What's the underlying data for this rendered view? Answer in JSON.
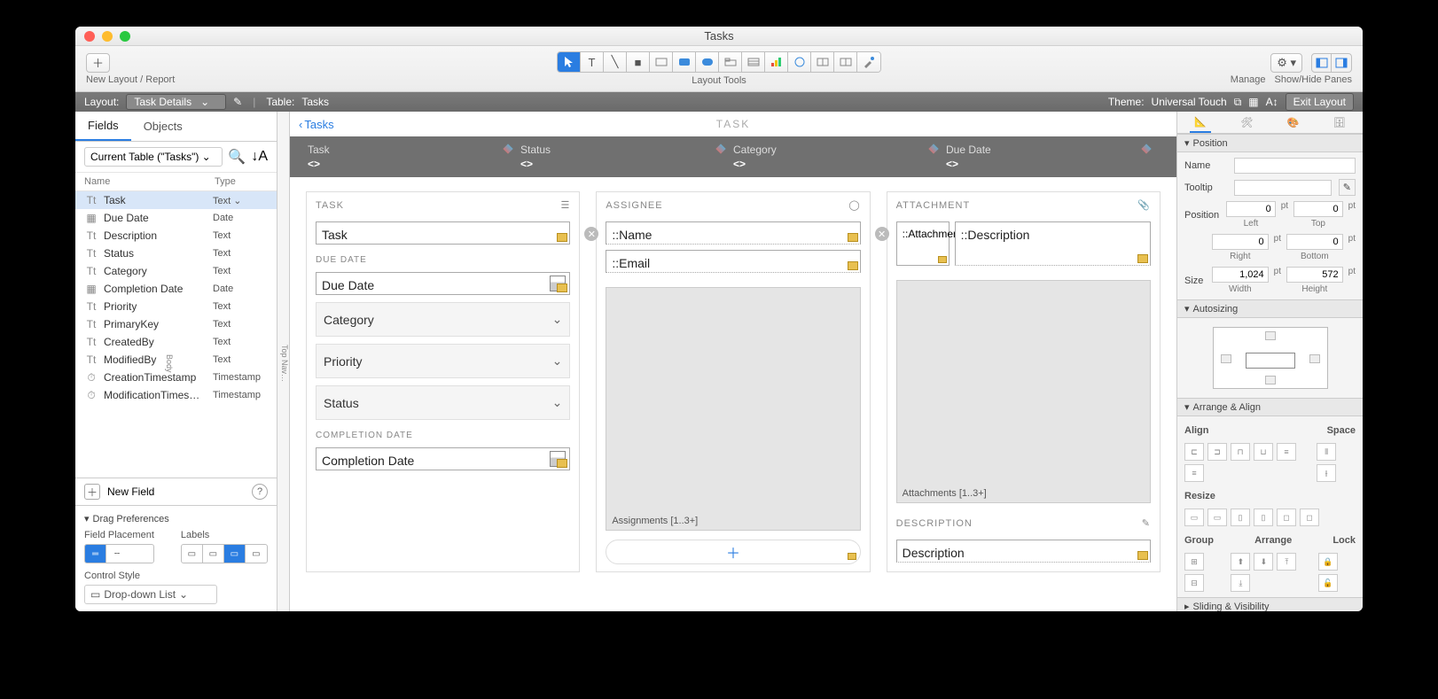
{
  "window": {
    "title": "Tasks"
  },
  "toolbar": {
    "newLayout": "New Layout / Report",
    "layoutTools": "Layout Tools",
    "manage": "Manage",
    "showHide": "Show/Hide Panes"
  },
  "statusbar": {
    "layoutLabel": "Layout:",
    "layoutName": "Task Details",
    "tableLabel": "Table:",
    "tableName": "Tasks",
    "themeLabel": "Theme:",
    "themeName": "Universal Touch",
    "exit": "Exit Layout"
  },
  "leftPanel": {
    "tabs": [
      "Fields",
      "Objects"
    ],
    "tableSelect": "Current Table (\"Tasks\")",
    "headers": {
      "name": "Name",
      "type": "Type"
    },
    "fields": [
      {
        "icon": "Tt",
        "name": "Task",
        "type": "Text",
        "sel": true
      },
      {
        "icon": "▦",
        "name": "Due Date",
        "type": "Date"
      },
      {
        "icon": "Tt",
        "name": "Description",
        "type": "Text"
      },
      {
        "icon": "Tt",
        "name": "Status",
        "type": "Text"
      },
      {
        "icon": "Tt",
        "name": "Category",
        "type": "Text"
      },
      {
        "icon": "▦",
        "name": "Completion Date",
        "type": "Date"
      },
      {
        "icon": "Tt",
        "name": "Priority",
        "type": "Text"
      },
      {
        "icon": "Tt",
        "name": "PrimaryKey",
        "type": "Text"
      },
      {
        "icon": "Tt",
        "name": "CreatedBy",
        "type": "Text"
      },
      {
        "icon": "Tt",
        "name": "ModifiedBy",
        "type": "Text"
      },
      {
        "icon": "⏱",
        "name": "CreationTimestamp",
        "type": "Timestamp"
      },
      {
        "icon": "⏱",
        "name": "ModificationTimes…",
        "type": "Timestamp"
      }
    ],
    "newField": "New Field",
    "dragPrefs": {
      "title": "Drag Preferences",
      "fieldPlacement": "Field Placement",
      "labels": "Labels",
      "controlStyle": "Control Style",
      "controlValue": "Drop-down List"
    }
  },
  "rulerParts": {
    "top": "Top Nav…",
    "body": "Body"
  },
  "canvas": {
    "backLabel": "Tasks",
    "pageLabel": "TASK",
    "headerCols": [
      {
        "label": "Task",
        "merge": "<<Task>>"
      },
      {
        "label": "Status",
        "merge": "<<Status>>"
      },
      {
        "label": "Category",
        "merge": "<<Category>>"
      },
      {
        "label": "Due Date",
        "merge": "<<Due Date>>"
      }
    ],
    "card1": {
      "title": "TASK",
      "taskLabel": "TASK",
      "taskField": "Task",
      "dueLabel": "DUE DATE",
      "dueField": "Due Date",
      "categoryField": "Category",
      "priorityField": "Priority",
      "statusField": "Status",
      "compLabel": "COMPLETION DATE",
      "compField": "Completion Date"
    },
    "card2": {
      "title": "ASSIGNEE",
      "nameField": "::Name",
      "emailField": "::Email",
      "portalLabel": "Assignments [1..3+]"
    },
    "card3": {
      "title": "ATTACHMENT",
      "attField": "::Attachment",
      "descField": "::Description",
      "portalLabel": "Attachments [1..3+]",
      "descSection": "DESCRIPTION",
      "descField2": "Description"
    }
  },
  "inspector": {
    "sections": {
      "position": "Position",
      "autosizing": "Autosizing",
      "arrange": "Arrange & Align",
      "sliding": "Sliding & Visibility"
    },
    "position": {
      "name": "Name",
      "tooltip": "Tooltip",
      "position": "Position",
      "left": "Left",
      "top": "Top",
      "right": "Right",
      "bottom": "Bottom",
      "leftVal": "0",
      "topVal": "0",
      "rightVal": "0",
      "bottomVal": "0",
      "size": "Size",
      "width": "Width",
      "height": "Height",
      "widthVal": "1,024",
      "heightVal": "572",
      "pt": "pt"
    },
    "arrange": {
      "align": "Align",
      "space": "Space",
      "resize": "Resize",
      "group": "Group",
      "arrange": "Arrange",
      "lock": "Lock"
    }
  }
}
